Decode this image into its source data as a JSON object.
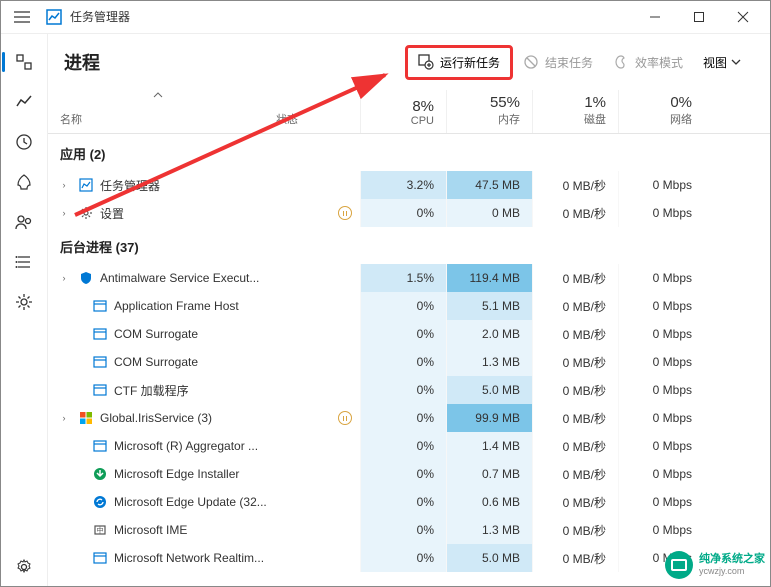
{
  "window": {
    "title": "任务管理器"
  },
  "page": {
    "title": "进程",
    "actions": {
      "new_task": "运行新任务",
      "end_task": "结束任务",
      "efficiency": "效率模式",
      "view": "视图"
    }
  },
  "columns": {
    "name": "名称",
    "status": "状态",
    "cpu": {
      "pct": "8%",
      "label": "CPU"
    },
    "memory": {
      "pct": "55%",
      "label": "内存"
    },
    "disk": {
      "pct": "1%",
      "label": "磁盘"
    },
    "network": {
      "pct": "0%",
      "label": "网络"
    }
  },
  "groups": {
    "apps": "应用 (2)",
    "background": "后台进程 (37)"
  },
  "rows": [
    {
      "expand": true,
      "icon": "taskmgr",
      "name": "任务管理器",
      "status": "",
      "cpu": "3.2%",
      "mem": "47.5 MB",
      "disk": "0 MB/秒",
      "net": "0 Mbps",
      "cpu_heat": 2,
      "mem_heat": 3
    },
    {
      "expand": true,
      "icon": "settings",
      "name": "设置",
      "status": "paused",
      "cpu": "0%",
      "mem": "0 MB",
      "disk": "0 MB/秒",
      "net": "0 Mbps",
      "cpu_heat": 1,
      "mem_heat": 1
    },
    {
      "expand": true,
      "icon": "defender",
      "name": "Antimalware Service Execut...",
      "status": "",
      "cpu": "1.5%",
      "mem": "119.4 MB",
      "disk": "0 MB/秒",
      "net": "0 Mbps",
      "cpu_heat": 2,
      "mem_heat": 4
    },
    {
      "expand": false,
      "icon": "window",
      "name": "Application Frame Host",
      "status": "",
      "cpu": "0%",
      "mem": "5.1 MB",
      "disk": "0 MB/秒",
      "net": "0 Mbps",
      "cpu_heat": 1,
      "mem_heat": 2
    },
    {
      "expand": false,
      "icon": "window",
      "name": "COM Surrogate",
      "status": "",
      "cpu": "0%",
      "mem": "2.0 MB",
      "disk": "0 MB/秒",
      "net": "0 Mbps",
      "cpu_heat": 1,
      "mem_heat": 1
    },
    {
      "expand": false,
      "icon": "window",
      "name": "COM Surrogate",
      "status": "",
      "cpu": "0%",
      "mem": "1.3 MB",
      "disk": "0 MB/秒",
      "net": "0 Mbps",
      "cpu_heat": 1,
      "mem_heat": 1
    },
    {
      "expand": false,
      "icon": "window",
      "name": "CTF 加载程序",
      "status": "",
      "cpu": "0%",
      "mem": "5.0 MB",
      "disk": "0 MB/秒",
      "net": "0 Mbps",
      "cpu_heat": 1,
      "mem_heat": 2
    },
    {
      "expand": true,
      "icon": "iris",
      "name": "Global.IrisService (3)",
      "status": "paused",
      "cpu": "0%",
      "mem": "99.9 MB",
      "disk": "0 MB/秒",
      "net": "0 Mbps",
      "cpu_heat": 1,
      "mem_heat": 4
    },
    {
      "expand": false,
      "icon": "window",
      "name": "Microsoft (R) Aggregator ...",
      "status": "",
      "cpu": "0%",
      "mem": "1.4 MB",
      "disk": "0 MB/秒",
      "net": "0 Mbps",
      "cpu_heat": 1,
      "mem_heat": 1
    },
    {
      "expand": false,
      "icon": "edge-install",
      "name": "Microsoft Edge Installer",
      "status": "",
      "cpu": "0%",
      "mem": "0.7 MB",
      "disk": "0 MB/秒",
      "net": "0 Mbps",
      "cpu_heat": 1,
      "mem_heat": 1
    },
    {
      "expand": false,
      "icon": "edge-update",
      "name": "Microsoft Edge Update (32...",
      "status": "",
      "cpu": "0%",
      "mem": "0.6 MB",
      "disk": "0 MB/秒",
      "net": "0 Mbps",
      "cpu_heat": 1,
      "mem_heat": 1
    },
    {
      "expand": false,
      "icon": "ime",
      "name": "Microsoft IME",
      "status": "",
      "cpu": "0%",
      "mem": "1.3 MB",
      "disk": "0 MB/秒",
      "net": "0 Mbps",
      "cpu_heat": 1,
      "mem_heat": 1
    },
    {
      "expand": false,
      "icon": "window",
      "name": "Microsoft Network Realtim...",
      "status": "",
      "cpu": "0%",
      "mem": "5.0 MB",
      "disk": "0 MB/秒",
      "net": "0 Mbps",
      "cpu_heat": 1,
      "mem_heat": 2
    }
  ],
  "watermark": {
    "cn": "纯净系统之家",
    "en": "ycwzjy.com"
  }
}
